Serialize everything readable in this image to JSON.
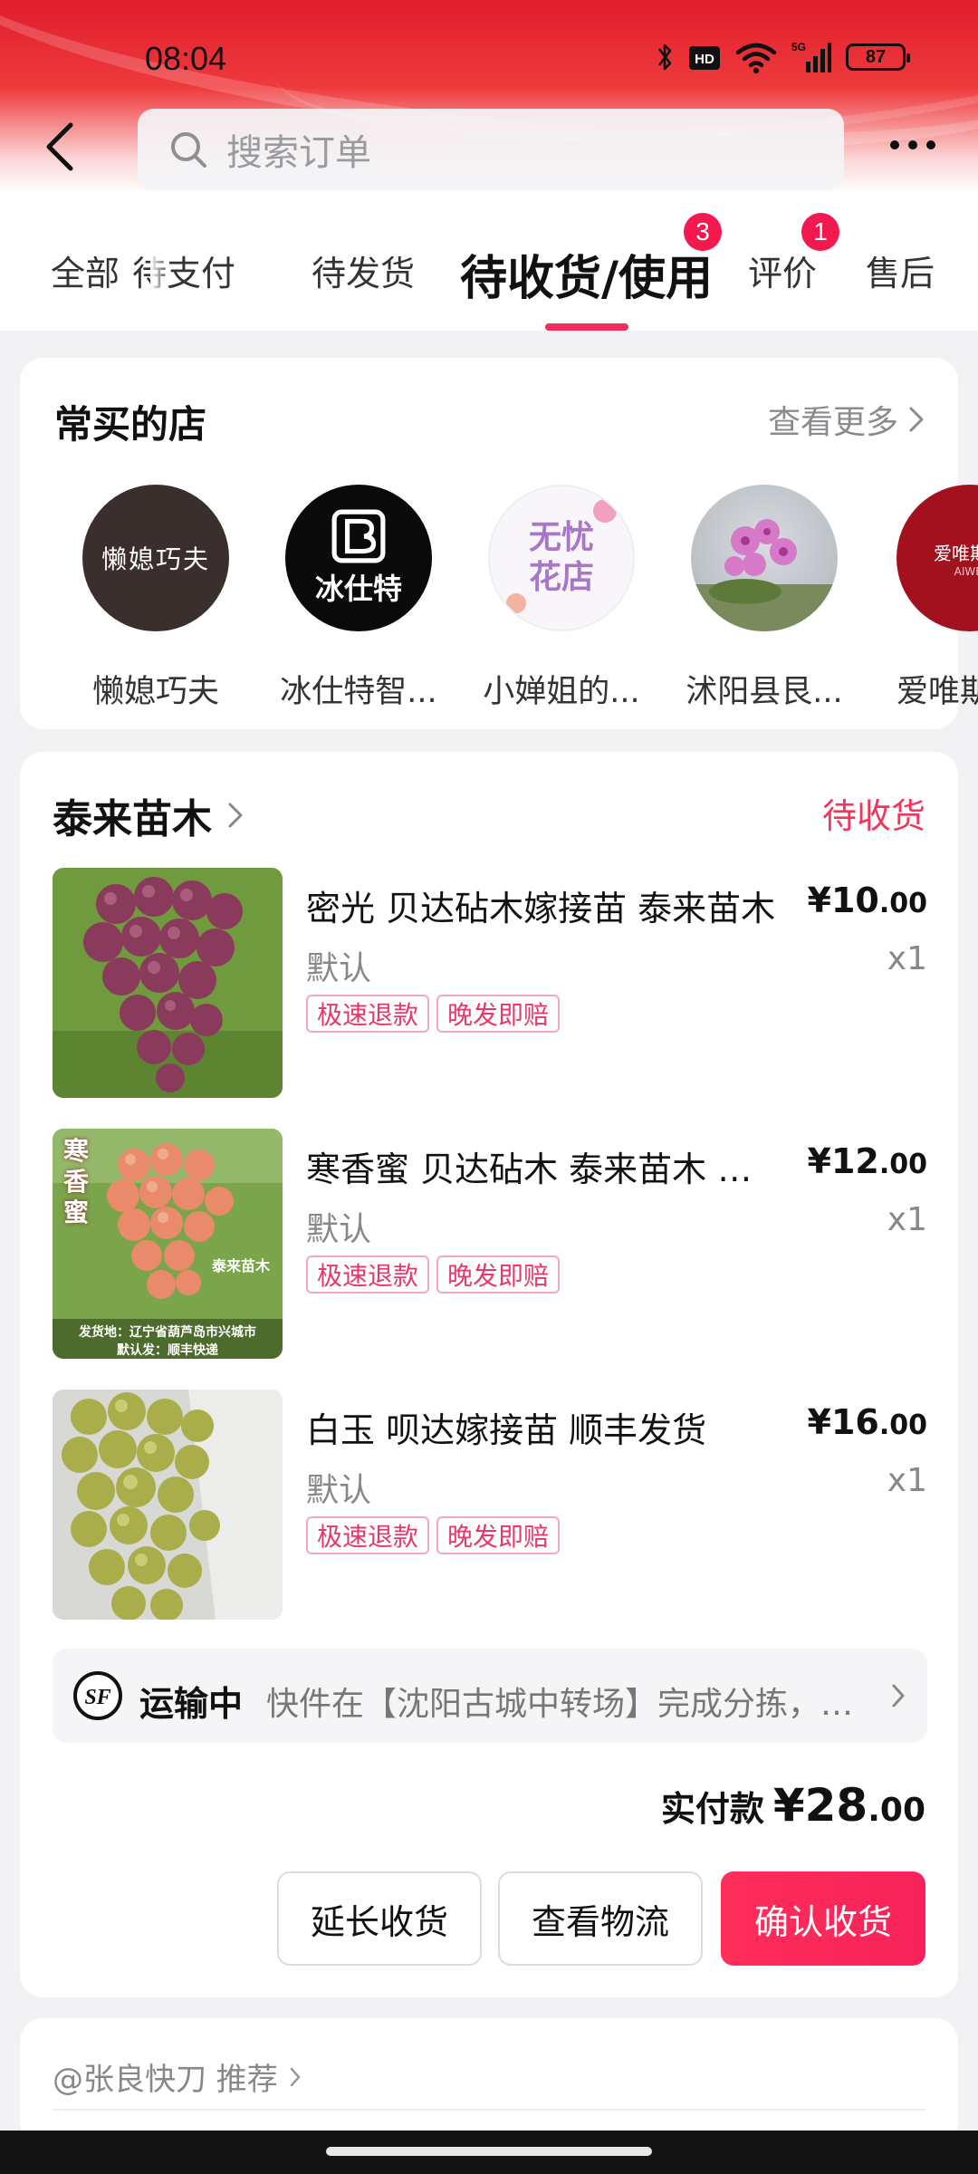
{
  "status_bar": {
    "time": "08:04",
    "battery": "87",
    "signal_label": "5G",
    "hd_label": "HD"
  },
  "header": {
    "search_placeholder": "搜索订单",
    "icons": [
      "back-icon",
      "search-icon",
      "more-icon"
    ]
  },
  "tabs": [
    {
      "label": "全部"
    },
    {
      "label": "待支付"
    },
    {
      "label": "待发货"
    },
    {
      "label": "待收货/使用",
      "badge": "3",
      "active": true
    },
    {
      "label": "评价",
      "badge": "1"
    },
    {
      "label": "售后"
    }
  ],
  "frequent_shops": {
    "title": "常买的店",
    "see_more": "查看更多",
    "shops": [
      {
        "name": "懒媳巧夫",
        "logo_text": "懒媳巧夫"
      },
      {
        "name": "冰仕特智...",
        "logo_text": "冰仕特"
      },
      {
        "name": "小婵姐的...",
        "logo_text": "无忧花店"
      },
      {
        "name": "沭阳县艮...",
        "logo_text": ""
      },
      {
        "name": "爱唯斯",
        "logo_text": "爱唯斯严",
        "logo_subtext": "AIWEI"
      }
    ]
  },
  "order": {
    "store_name": "泰来苗木",
    "status": "待收货",
    "items": [
      {
        "title": "密光 贝达砧木嫁接苗 泰来苗木",
        "price_main": "¥10",
        "price_cents": ".00",
        "variant": "默认",
        "qty": "x1",
        "tags": [
          "极速退款",
          "晚发即赔"
        ]
      },
      {
        "title": "寒香蜜 贝达砧木 泰来苗木 顺丰发货",
        "price_main": "¥12",
        "price_cents": ".00",
        "variant": "默认",
        "qty": "x1",
        "tags": [
          "极速退款",
          "晚发即赔"
        ],
        "image_overlay": {
          "vertical_text": "寒香蜜",
          "brand": "泰来苗木",
          "line1": "发货地：辽宁省葫芦岛市兴城市",
          "line2": "默认发：顺丰快递"
        }
      },
      {
        "title": "白玉  呗达嫁接苗  顺丰发货",
        "price_main": "¥16",
        "price_cents": ".00",
        "variant": "默认",
        "qty": "x1",
        "tags": [
          "极速退款",
          "晚发即赔"
        ]
      }
    ],
    "shipping": {
      "status": "运输中",
      "detail": "快件在【沈阳古城中转场】完成分拣，准备发往下一站",
      "carrier_icon": "sf-express-icon"
    },
    "total_label": "实付款",
    "total_main": "¥28",
    "total_cents": ".00",
    "buttons": {
      "extend": "延长收货",
      "logistics": "查看物流",
      "confirm": "确认收货"
    }
  },
  "recommend": {
    "text": "@张良快刀 推荐"
  },
  "colors": {
    "accent": "#f02e5b",
    "header_red": "#e01e2d",
    "tag_text": "#e8386a"
  }
}
